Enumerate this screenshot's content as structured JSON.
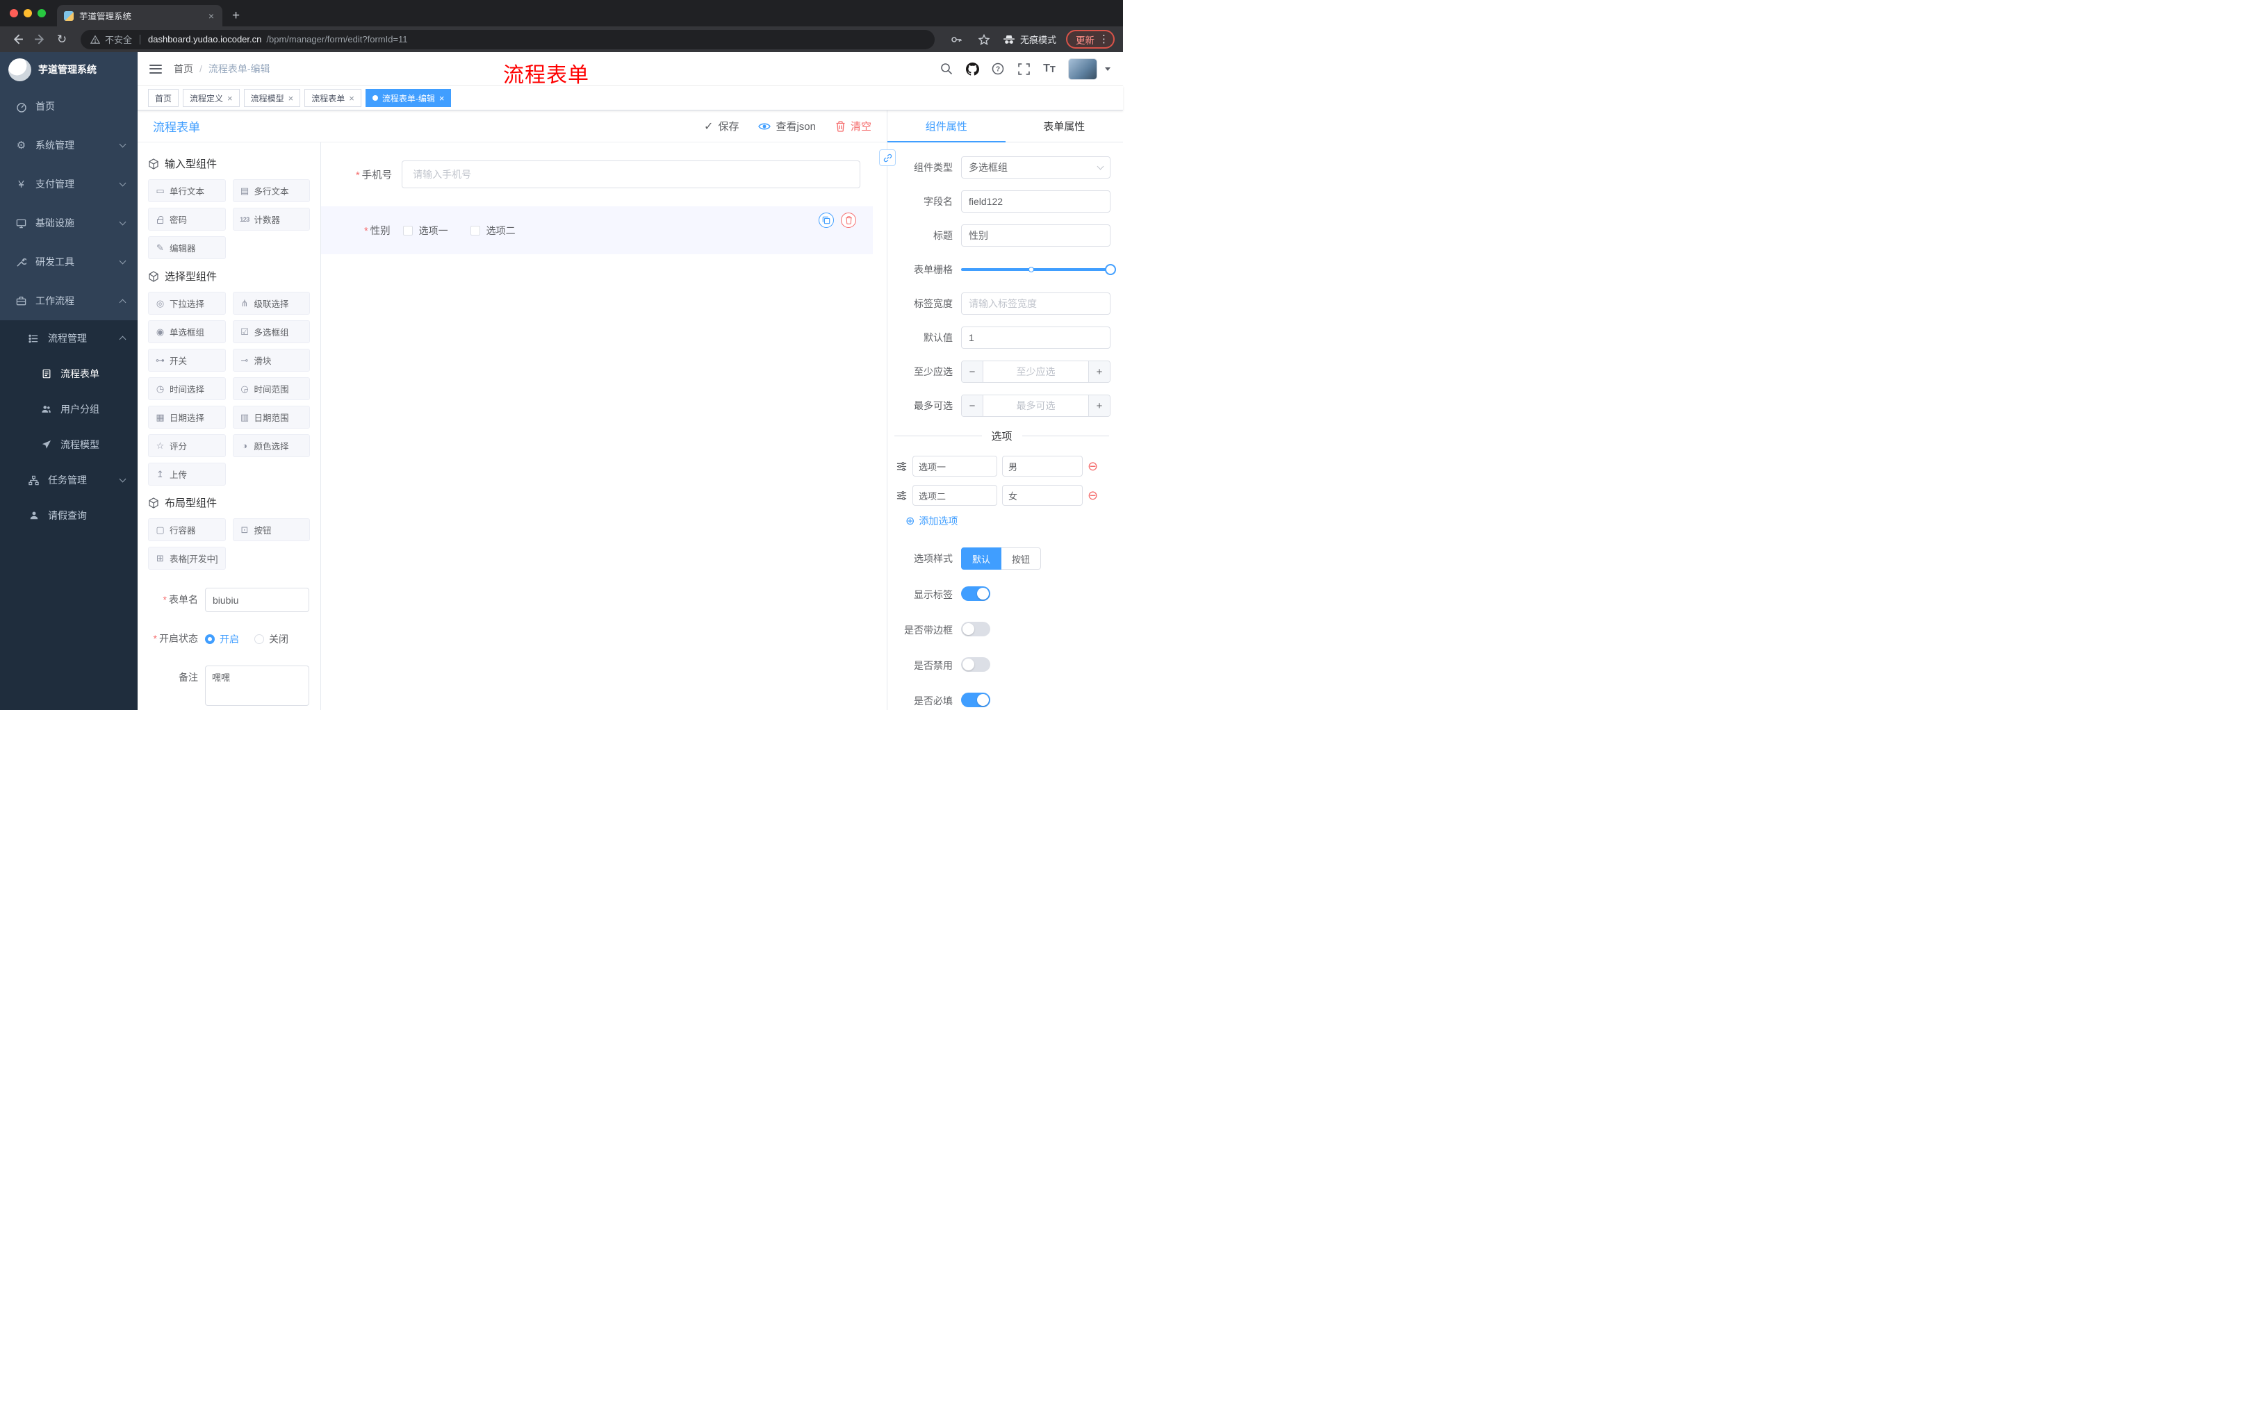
{
  "colors": {
    "accent": "#409EFF",
    "danger": "#F56C6C",
    "sidebar_bg": "#304156",
    "submenu_bg": "#1F2D3D",
    "annotation_red": "#FE0000",
    "chrome_dark": "#202124",
    "chrome_toolbar": "#35363A"
  },
  "browser": {
    "tab_title": "芋道管理系统",
    "not_secure_label": "不安全",
    "url_domain": "dashboard.yudao.iocoder.cn",
    "url_path": "/bpm/manager/form/edit?formId=11",
    "incognito_label": "无痕模式",
    "update_label": "更新"
  },
  "sidebar": {
    "logo_title": "芋道管理系统",
    "items": [
      {
        "icon": "dashboard-icon",
        "label": "首页"
      },
      {
        "icon": "gear-icon",
        "label": "系统管理",
        "chevron": "down"
      },
      {
        "icon": "yen-icon",
        "label": "支付管理",
        "chevron": "down"
      },
      {
        "icon": "infrastructure-icon",
        "label": "基础设施",
        "chevron": "down"
      },
      {
        "icon": "tools-icon",
        "label": "研发工具",
        "chevron": "down"
      },
      {
        "icon": "briefcase-icon",
        "label": "工作流程",
        "chevron": "up"
      },
      {
        "icon": "list-icon",
        "label": "流程管理",
        "chevron": "up"
      },
      {
        "icon": "form-icon",
        "label": "流程表单",
        "active": true
      },
      {
        "icon": "users-icon",
        "label": "用户分组"
      },
      {
        "icon": "send-icon",
        "label": "流程模型"
      },
      {
        "icon": "tree-icon",
        "label": "任务管理",
        "chevron": "down"
      },
      {
        "icon": "person-icon",
        "label": "请假查询"
      }
    ]
  },
  "header": {
    "breadcrumb_home": "首页",
    "breadcrumb_current": "流程表单-编辑",
    "annotation": "流程表单"
  },
  "tags": [
    {
      "label": "首页",
      "closable": false,
      "active": false
    },
    {
      "label": "流程定义",
      "closable": true,
      "active": false
    },
    {
      "label": "流程模型",
      "closable": true,
      "active": false
    },
    {
      "label": "流程表单",
      "closable": true,
      "active": false
    },
    {
      "label": "流程表单-编辑",
      "closable": true,
      "active": true
    }
  ],
  "designer": {
    "title": "流程表单",
    "toolbar": {
      "save_label": "保存",
      "view_json_label": "查看json",
      "clear_label": "清空"
    },
    "palette": {
      "sections": [
        {
          "title": "输入型组件",
          "items": [
            {
              "icon": "single-line-text-icon",
              "glyph": "▭",
              "label": "单行文本"
            },
            {
              "icon": "textarea-icon",
              "glyph": "▤",
              "label": "多行文本"
            },
            {
              "icon": "lock-icon",
              "glyph": "",
              "label": "密码"
            },
            {
              "icon": "counter-icon",
              "glyph": "123",
              "label": "计数器"
            },
            {
              "icon": "editor-icon",
              "glyph": "✎",
              "label": "编辑器"
            }
          ]
        },
        {
          "title": "选择型组件",
          "items": [
            {
              "icon": "select-icon",
              "glyph": "◎",
              "label": "下拉选择"
            },
            {
              "icon": "cascader-icon",
              "glyph": "⋔",
              "label": "级联选择"
            },
            {
              "icon": "radio-group-icon",
              "glyph": "◉",
              "label": "单选框组"
            },
            {
              "icon": "checkbox-group-icon",
              "glyph": "☑",
              "label": "多选框组"
            },
            {
              "icon": "switch-icon",
              "glyph": "⊶",
              "label": "开关"
            },
            {
              "icon": "slider-icon",
              "glyph": "⊸",
              "label": "滑块"
            },
            {
              "icon": "time-picker-icon",
              "glyph": "◷",
              "label": "时间选择"
            },
            {
              "icon": "time-range-icon",
              "glyph": "◶",
              "label": "时间范围"
            },
            {
              "icon": "date-picker-icon",
              "glyph": "▦",
              "label": "日期选择"
            },
            {
              "icon": "date-range-icon",
              "glyph": "▥",
              "label": "日期范围"
            },
            {
              "icon": "rate-icon",
              "glyph": "☆",
              "label": "评分"
            },
            {
              "icon": "color-picker-icon",
              "glyph": "◑",
              "label": "颜色选择"
            },
            {
              "icon": "upload-icon",
              "glyph": "↥",
              "label": "上传"
            }
          ]
        },
        {
          "title": "布局型组件",
          "items": [
            {
              "icon": "row-container-icon",
              "glyph": "▢",
              "label": "行容器"
            },
            {
              "icon": "button-icon",
              "glyph": "⊡",
              "label": "按钮"
            },
            {
              "icon": "table-icon",
              "glyph": "⊞",
              "label": "表格[开发中]"
            }
          ]
        }
      ]
    },
    "form_meta": {
      "name_label": "表单名",
      "name_value": "biubiu",
      "status_label": "开启状态",
      "status_on": "开启",
      "status_off": "关闭",
      "remark_label": "备注",
      "remark_value": "嘿嘿"
    },
    "canvas": {
      "phone_label": "手机号",
      "phone_placeholder": "请输入手机号",
      "gender_label": "性别",
      "gender_options": [
        "选项一",
        "选项二"
      ]
    }
  },
  "props": {
    "tabs": {
      "component": "组件属性",
      "form": "表单属性"
    },
    "rows": {
      "component_type": {
        "label": "组件类型",
        "value": "多选框组"
      },
      "field_name": {
        "label": "字段名",
        "value": "field122"
      },
      "title": {
        "label": "标题",
        "value": "性别"
      },
      "grid": {
        "label": "表单栅格"
      },
      "label_width": {
        "label": "标签宽度",
        "placeholder": "请输入标签宽度"
      },
      "default_value": {
        "label": "默认值",
        "value": "1"
      },
      "min_select": {
        "label": "至少应选",
        "placeholder": "至少应选"
      },
      "max_select": {
        "label": "最多可选",
        "placeholder": "最多可选"
      }
    },
    "options": {
      "divider": "选项",
      "rows": [
        {
          "label": "选项一",
          "value": "男"
        },
        {
          "label": "选项二",
          "value": "女"
        }
      ],
      "add_label": "添加选项"
    },
    "style": {
      "label": "选项样式",
      "default_choice": "默认",
      "button_choice": "按钮"
    },
    "switches": [
      {
        "label": "显示标签",
        "on": true
      },
      {
        "label": "是否带边框",
        "on": false
      },
      {
        "label": "是否禁用",
        "on": false
      },
      {
        "label": "是否必填",
        "on": true
      }
    ]
  }
}
